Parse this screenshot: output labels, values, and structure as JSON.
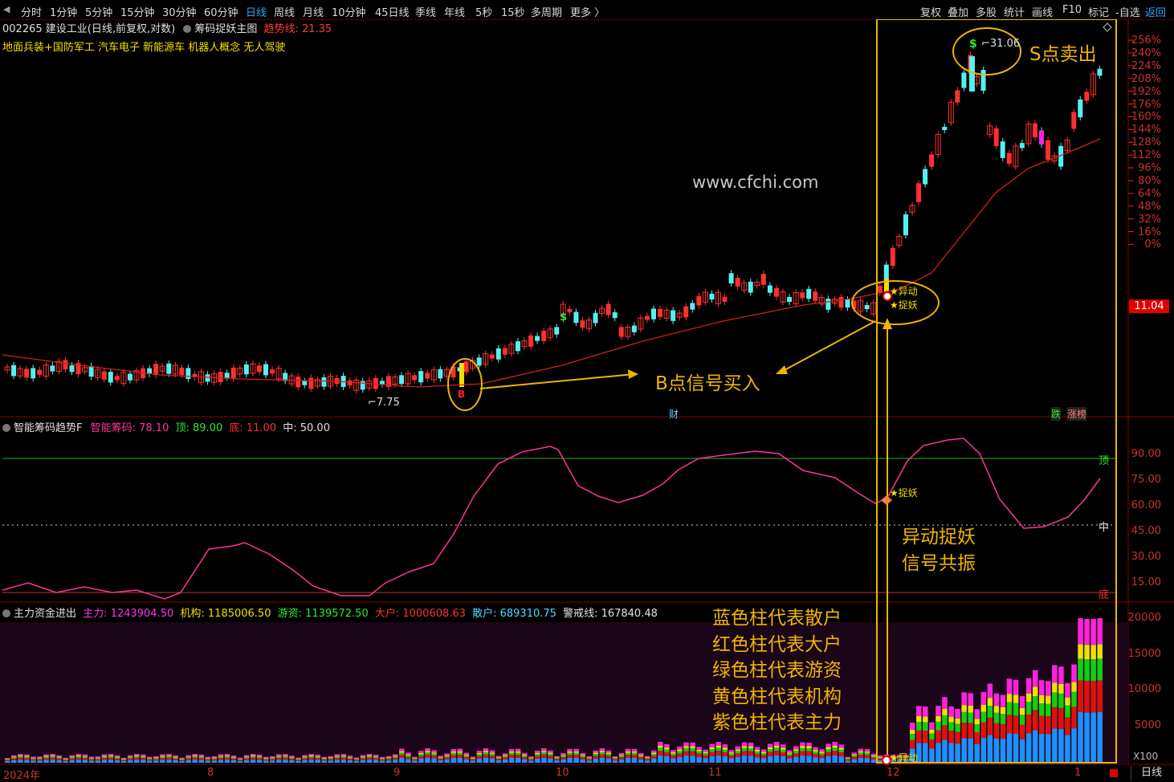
{
  "toolbar": {
    "periods": [
      {
        "label": "分时",
        "active": false
      },
      {
        "label": "1分钟",
        "active": false
      },
      {
        "label": "5分钟",
        "active": false
      },
      {
        "label": "15分钟",
        "active": false
      },
      {
        "label": "30分钟",
        "active": false
      },
      {
        "label": "60分钟",
        "active": false
      },
      {
        "label": "日线",
        "active": true
      },
      {
        "label": "周线",
        "active": false
      },
      {
        "label": "月线",
        "active": false
      },
      {
        "label": "10分钟",
        "active": false
      },
      {
        "label": "45日线",
        "active": false
      },
      {
        "label": "季线",
        "active": false
      },
      {
        "label": "年线",
        "active": false
      },
      {
        "label": "5秒",
        "active": false
      },
      {
        "label": "15秒",
        "active": false
      },
      {
        "label": "多周期",
        "active": false
      },
      {
        "label": "更多 〉",
        "active": false
      }
    ],
    "right_items": [
      {
        "label": "复权",
        "active": false
      },
      {
        "label": "叠加",
        "active": false
      },
      {
        "label": "多股",
        "active": false
      },
      {
        "label": "统计",
        "active": false
      },
      {
        "label": "画线",
        "active": false
      },
      {
        "label": "F10",
        "active": false
      },
      {
        "label": "标记",
        "active": false
      },
      {
        "label": "-自选",
        "active": false
      },
      {
        "label": "返回",
        "active": true
      }
    ]
  },
  "main": {
    "stock_title": "002265 建设工业(日线,前复权,对数)",
    "indicator_name": "筹码捉妖主图",
    "trend_label": "趋势线: 21.35",
    "concepts": "地面兵装+国防军工 汽车电子 新能源车 机器人概念 无人驾驶",
    "current_price": "11.04",
    "high_label": "31.06",
    "low_label": "7.75",
    "axis_labels": [
      "256%",
      "240%",
      "224%",
      "208%",
      "192%",
      "176%",
      "160%",
      "144%",
      "128%",
      "112%",
      "96%",
      "80%",
      "64%",
      "48%",
      "32%",
      "16%",
      "0%"
    ],
    "markers": {
      "cai": "财",
      "die": "跌",
      "zhangbang": "涨榜",
      "b_mark": "B",
      "s_mark": "$"
    }
  },
  "indicator": {
    "name": "智能筹码趋势F",
    "chip_label": "智能筹码: 78.10",
    "top_label": "顶: 89.00",
    "bottom_label": "底: 11.00",
    "mid_label": "中: 50.00",
    "line_top": "顶",
    "line_mid": "中",
    "line_bottom": "底",
    "axis_labels": [
      "90.00",
      "75.00",
      "60.00",
      "45.00",
      "30.00",
      "15.00"
    ]
  },
  "funds": {
    "name": "主力资金进出",
    "main_label": "主力: 1243904.50",
    "inst_label": "机构: 1185006.50",
    "hot_label": "游资: 1139572.50",
    "big_label": "大户: 1000608.63",
    "retail_label": "散户: 689310.75",
    "warn_label": "警戒线: 167840.48",
    "axis_labels": [
      "20000",
      "15000",
      "10000",
      "5000"
    ],
    "multiplier": "X100"
  },
  "date_axis": {
    "labels": [
      "2024年",
      "8",
      "9",
      "10",
      "11",
      "12",
      "1"
    ]
  },
  "bottom_tab": "日线",
  "watermark": "www.cfchi.com",
  "annotations": {
    "s_sell": "S点卖出",
    "b_buy": "B点信号买入",
    "resonance_1": "异动捉妖",
    "resonance_2": "信号共振",
    "legend": [
      "蓝色柱代表散户",
      "红色柱代表大户",
      "绿色柱代表游资",
      "黄色柱代表机构",
      "紫色柱代表主力"
    ],
    "yidong": "★异动",
    "zhuoyao": "★捉妖"
  },
  "colors": {
    "up_candle": "#ff2f2f",
    "down_candle": "#54f0f0",
    "pink": "#ff3399",
    "purple": "#ff22dd",
    "gold": "#f0b400",
    "red_axis": "#d03030",
    "green_line": "#2eaa2e",
    "blue_bar": "#1e90ff"
  }
}
